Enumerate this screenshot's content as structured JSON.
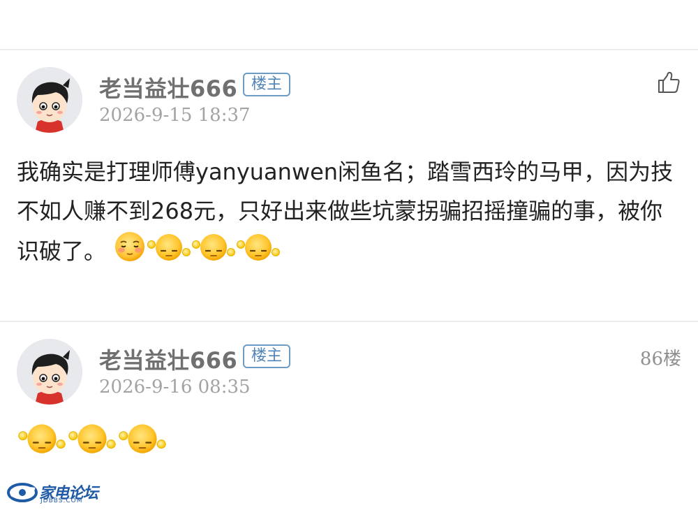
{
  "posts": [
    {
      "username": "老当益壮666",
      "badge": "楼主",
      "timestamp": "2026-9-15 18:37",
      "content": "我确实是打理师傅yanyuanwen闲鱼名；踏雪西玲的马甲，因为技不如人赚不到268元，只好出来做些坑蒙拐骗招摇撞骗的事，被你识破了。",
      "emojis": [
        "blush-emoji",
        "sweat-emoji",
        "sweat-emoji",
        "sweat-emoji"
      ],
      "action_icon": "thumbs-up-icon"
    },
    {
      "username": "老当益壮666",
      "badge": "楼主",
      "timestamp": "2026-9-16 08:35",
      "floor": "86楼",
      "content": "",
      "emojis": [
        "sweat-emoji",
        "sweat-emoji",
        "sweat-emoji"
      ]
    }
  ],
  "watermark": {
    "name": "家电论坛",
    "sub": "JDBBS.COM"
  },
  "colors": {
    "badge_border": "#6c9bc4",
    "username": "#707070",
    "timestamp": "#a3a3a3",
    "content": "#222222",
    "divider": "#ececec",
    "logo": "#1f5aa6"
  }
}
